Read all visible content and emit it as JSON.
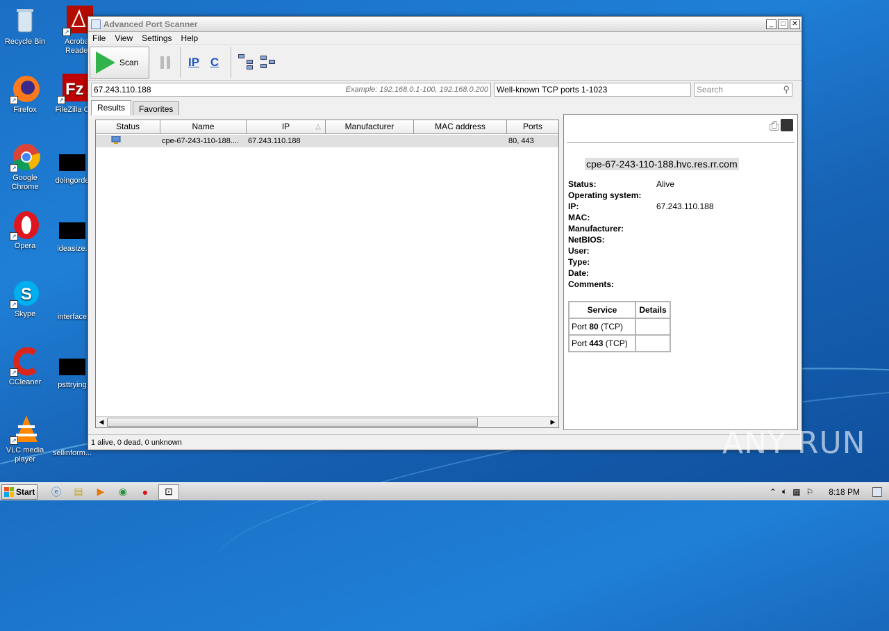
{
  "desktop": {
    "icons": [
      {
        "label": "Recycle Bin"
      },
      {
        "label": "Acrobat Reader"
      },
      {
        "label": "Firefox"
      },
      {
        "label": "FileZilla C"
      },
      {
        "label": "Google Chrome"
      },
      {
        "label": "doingorde"
      },
      {
        "label": "Opera"
      },
      {
        "label": "ideasize."
      },
      {
        "label": "Skype"
      },
      {
        "label": "interface"
      },
      {
        "label": "CCleaner"
      },
      {
        "label": "psttrying"
      },
      {
        "label": "VLC media player"
      },
      {
        "label": "sellinform..."
      }
    ]
  },
  "window": {
    "title": "Advanced Port Scanner",
    "menu": [
      "File",
      "View",
      "Settings",
      "Help"
    ],
    "toolbar": {
      "scan_label": "Scan",
      "ip_label": "IP",
      "c_label": "C"
    },
    "address": {
      "value": "67.243.110.188",
      "example": "Example: 192.168.0.1-100, 192.168.0.200",
      "ports": "Well-known TCP ports 1-1023",
      "search_placeholder": "Search"
    },
    "tabs": [
      "Results",
      "Favorites"
    ],
    "results": {
      "columns": [
        "Status",
        "Name",
        "IP",
        "Manufacturer",
        "MAC address",
        "Ports"
      ],
      "rows": [
        {
          "name": "cpe-67-243-110-188....",
          "ip": "67.243.110.188",
          "manufacturer": "",
          "mac": "",
          "ports": "80, 443"
        }
      ]
    },
    "details": {
      "hostname": "cpe-67-243-110-188.hvc.res.rr.com",
      "fields": [
        {
          "label": "Status:",
          "value": "Alive"
        },
        {
          "label": "Operating system:",
          "value": ""
        },
        {
          "label": "IP:",
          "value": "67.243.110.188"
        },
        {
          "label": "MAC:",
          "value": ""
        },
        {
          "label": "Manufacturer:",
          "value": ""
        },
        {
          "label": "NetBIOS:",
          "value": ""
        },
        {
          "label": "User:",
          "value": ""
        },
        {
          "label": "Type:",
          "value": ""
        },
        {
          "label": "Date:",
          "value": ""
        },
        {
          "label": "Comments:",
          "value": ""
        }
      ],
      "services_header": [
        "Service",
        "Details"
      ],
      "services": [
        {
          "prefix": "Port ",
          "port": "80",
          "suffix": " (TCP)"
        },
        {
          "prefix": "Port ",
          "port": "443",
          "suffix": " (TCP)"
        }
      ]
    },
    "status": "1 alive, 0 dead, 0 unknown"
  },
  "taskbar": {
    "start_label": "Start",
    "clock": "8:18 PM"
  },
  "watermark": "ANY RUN"
}
